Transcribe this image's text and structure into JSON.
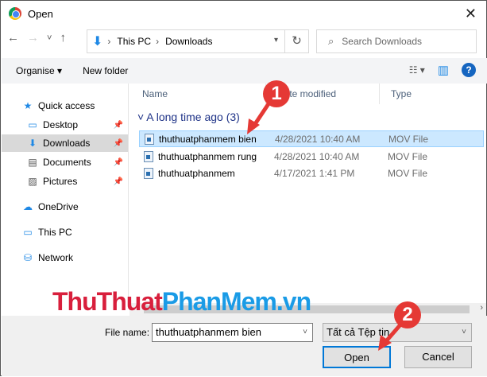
{
  "window": {
    "title": "Open",
    "close": "✕"
  },
  "nav": {
    "back": "←",
    "forward": "→",
    "recent": "˅",
    "up": "↑"
  },
  "address": {
    "segments": [
      "This PC",
      "Downloads"
    ],
    "refresh": "↻"
  },
  "search": {
    "placeholder": "Search Downloads",
    "icon": "⌕"
  },
  "toolbar": {
    "organise": "Organise ▾",
    "new_folder": "New folder",
    "view": "☷ ▾",
    "pane": "▥",
    "help": "?"
  },
  "sidebar": {
    "items": [
      {
        "label": "Quick access",
        "icon": "★"
      },
      {
        "label": "Desktop",
        "icon": "▭"
      },
      {
        "label": "Downloads",
        "icon": "⬇"
      },
      {
        "label": "Documents",
        "icon": "▤"
      },
      {
        "label": "Pictures",
        "icon": "▨"
      },
      {
        "label": "OneDrive",
        "icon": "☁"
      },
      {
        "label": "This PC",
        "icon": "▭"
      },
      {
        "label": "Network",
        "icon": "⛁"
      }
    ]
  },
  "columns": [
    "Name",
    "Date modified",
    "Type"
  ],
  "group": {
    "label": "A long time ago",
    "count": "(3)"
  },
  "files": [
    {
      "name": "thuthuatphanmem bien",
      "date": "4/28/2021 10:40 AM",
      "type": "MOV File"
    },
    {
      "name": "thuthuatphanmem rung",
      "date": "4/28/2021 10:40 AM",
      "type": "MOV File"
    },
    {
      "name": "thuthuatphanmem",
      "date": "4/17/2021 1:41 PM",
      "type": "MOV File"
    }
  ],
  "footer": {
    "file_name_label": "File name:",
    "file_name_value": "thuthuatphanmem bien",
    "file_type": "Tất cả Tệp tin",
    "open": "Open",
    "cancel": "Cancel"
  },
  "annotations": [
    "1",
    "2"
  ],
  "watermark": {
    "part1": "ThuThuat",
    "part2": "PhanMem.vn"
  }
}
